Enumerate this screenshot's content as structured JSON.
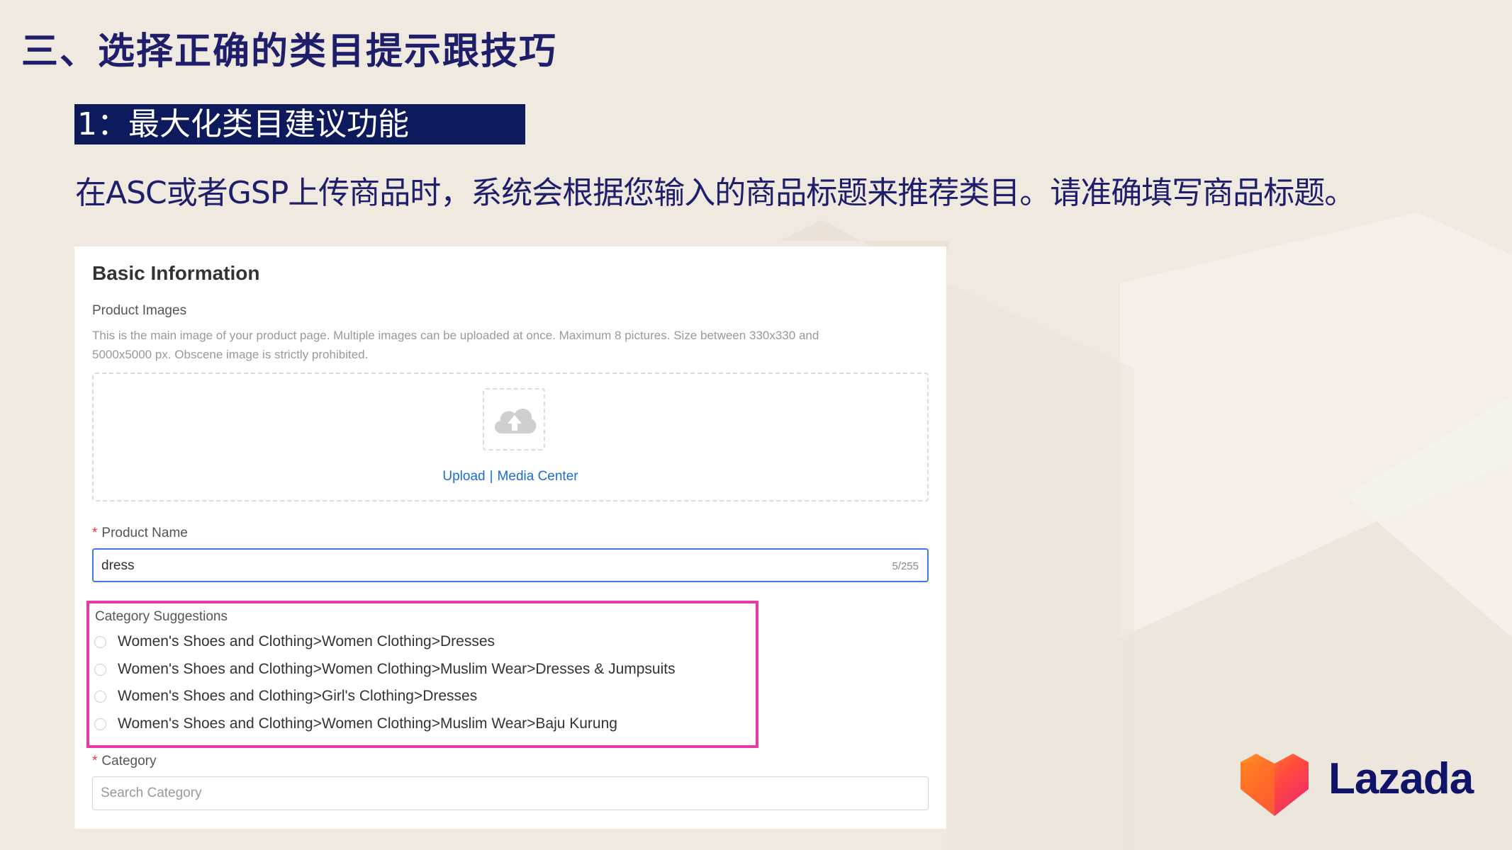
{
  "slide": {
    "title": "三、选择正确的类目提示跟技巧",
    "subtitle": "1：最大化类目建议功能",
    "description": "在ASC或者GSP上传商品时，系统会根据您输入的商品标题来推荐类目。请准确填写商品标题。"
  },
  "form": {
    "title": "Basic Information",
    "product_images": {
      "label": "Product Images",
      "help": "This is the main image of your product page. Multiple images can be uploaded at once. Maximum 8 pictures. Size between 330x330 and 5000x5000 px. Obscene image is strictly prohibited.",
      "upload_icon": "cloud-upload-icon",
      "upload_link": "Upload",
      "separator": "|",
      "media_center_link": "Media Center"
    },
    "product_name": {
      "required_mark": "*",
      "label": "Product Name",
      "value": "dress",
      "counter": "5/255"
    },
    "category_suggestions": {
      "label": "Category Suggestions",
      "items": [
        "Women's Shoes and Clothing>Women Clothing>Dresses",
        "Women's Shoes and Clothing>Women Clothing>Muslim Wear>Dresses & Jumpsuits",
        "Women's Shoes and Clothing>Girl's Clothing>Dresses",
        "Women's Shoes and Clothing>Women Clothing>Muslim Wear>Baju Kurung"
      ]
    },
    "category": {
      "required_mark": "*",
      "label": "Category",
      "placeholder": "Search Category"
    }
  },
  "brand": {
    "name": "Lazada",
    "icon": "lazada-heart-icon"
  },
  "colors": {
    "title": "#1e1e6b",
    "subtitle_bg": "#0d1a5c",
    "highlight": "#e83aa6",
    "link": "#1a6dd4",
    "focus_border": "#3d7be0"
  }
}
